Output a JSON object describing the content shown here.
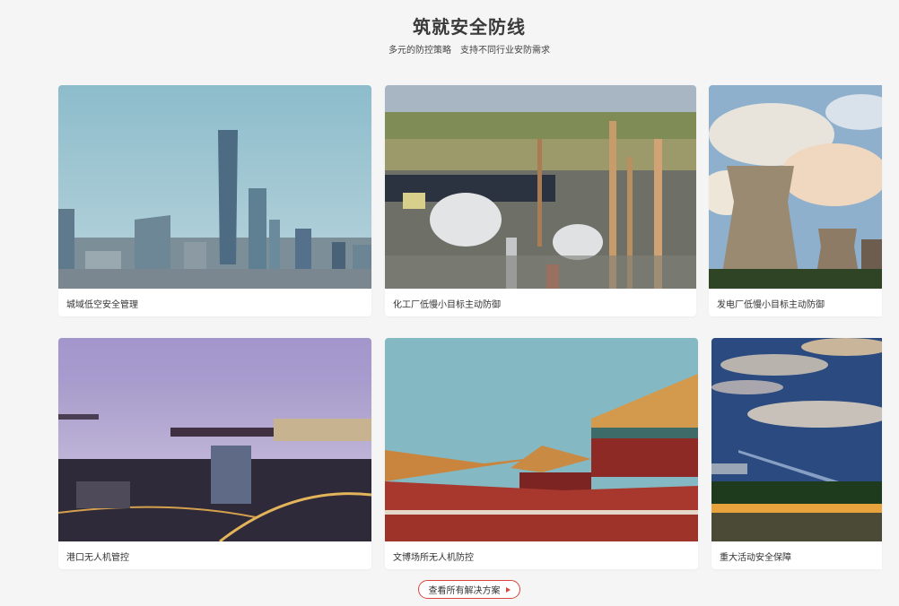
{
  "section": {
    "title": "筑就安全防线",
    "subtitle": "多元的防控策略　支持不同行业安防需求"
  },
  "cards": [
    {
      "caption": "城域低空安全管理"
    },
    {
      "caption": "化工厂低慢小目标主动防御"
    },
    {
      "caption": "发电厂低慢小目标主动防御"
    },
    {
      "caption": "港口无人机管控"
    },
    {
      "caption": "文博场所无人机防控"
    },
    {
      "caption": "重大活动安全保障"
    }
  ],
  "more_button": {
    "label": "查看所有解决方案"
  },
  "colors": {
    "accent": "#d9453d",
    "background": "#f5f5f6"
  }
}
